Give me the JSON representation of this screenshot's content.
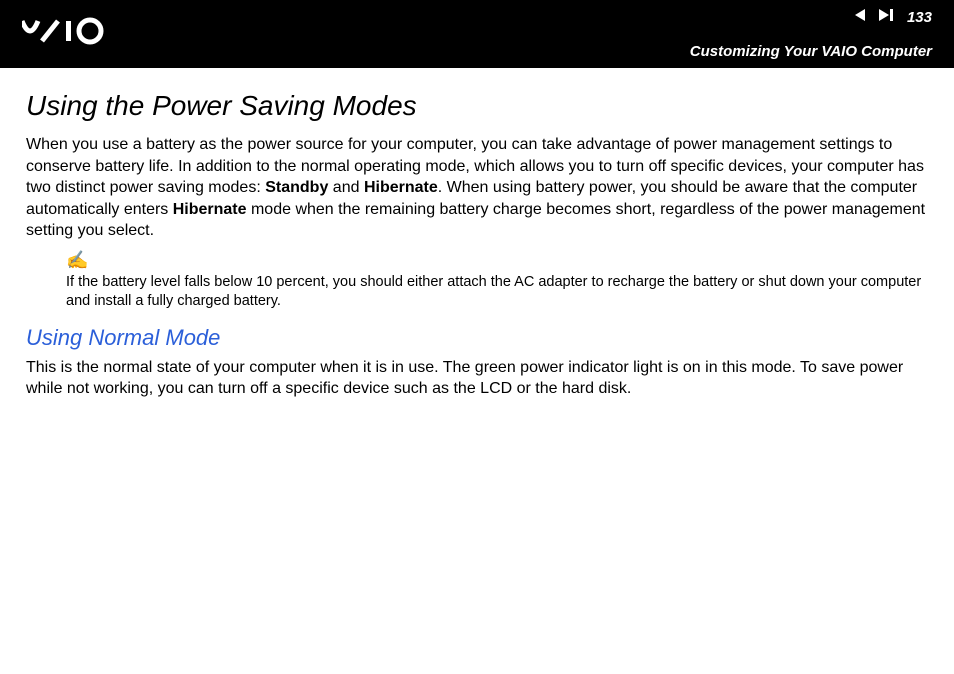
{
  "header": {
    "logo_text": "VAIO",
    "page_number": "133",
    "section_label": "Customizing Your VAIO Computer"
  },
  "content": {
    "title": "Using the Power Saving Modes",
    "para1_pre": "When you use a battery as the power source for your computer, you can take advantage of power management settings to conserve battery life. In addition to the normal operating mode, which allows you to turn off specific devices, your computer has two distinct power saving modes: ",
    "bold1": "Standby",
    "para1_mid1": " and ",
    "bold2": "Hibernate",
    "para1_mid2": ". When using battery power, you should be aware that the computer automatically enters ",
    "bold3": "Hibernate",
    "para1_post": " mode when the remaining battery charge becomes short, regardless of the power management setting you select.",
    "note_icon": "✍",
    "note_text": "If the battery level falls below 10 percent, you should either attach the AC adapter to recharge the battery or shut down your computer and install a fully charged battery.",
    "subtitle": "Using Normal Mode",
    "para2": "This is the normal state of your computer when it is in use. The green power indicator light is on in this mode. To save power while not working, you can turn off a specific device such as the LCD or the hard disk."
  }
}
